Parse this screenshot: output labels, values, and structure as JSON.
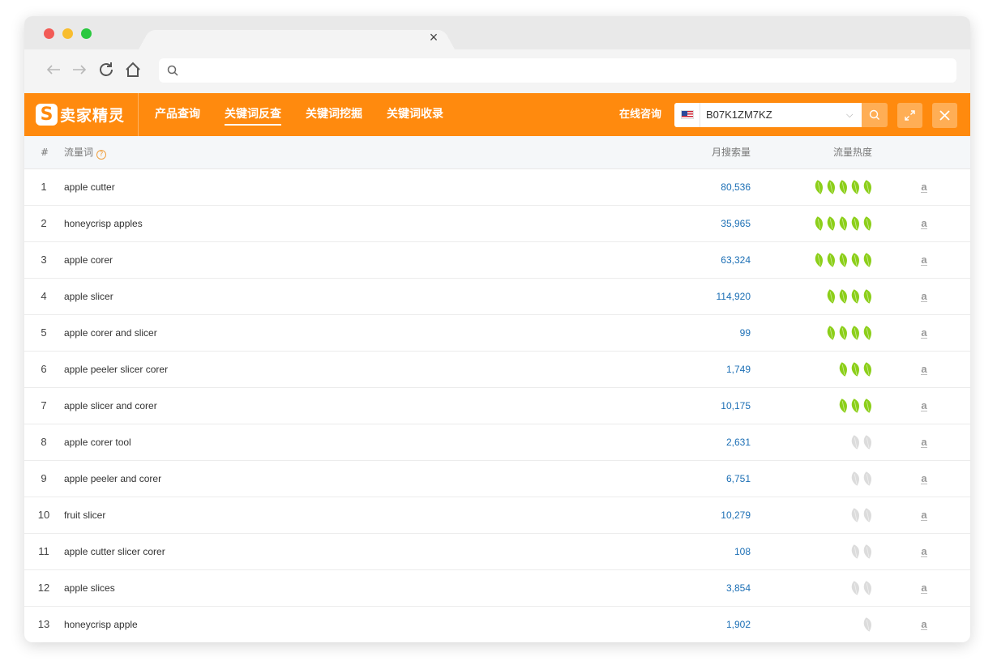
{
  "browser": {
    "tab_close": "×",
    "url": ""
  },
  "app": {
    "logo_mark": "S",
    "logo_text": "卖家精灵",
    "menu": [
      "产品查询",
      "关键词反查",
      "关键词挖掘",
      "关键词收录"
    ],
    "active_menu": 1,
    "consult_label": "在线咨询",
    "asin_value": "B07K1ZM7KZ",
    "caret": "⌵"
  },
  "table": {
    "headers": {
      "index": "#",
      "keyword": "流量词",
      "help": "?",
      "volume": "月搜索量",
      "heat": "流量热度"
    },
    "amazon_glyph": "a",
    "rows": [
      {
        "index": "1",
        "keyword": "apple cutter",
        "volume": "80,536",
        "heat": 5,
        "active": true
      },
      {
        "index": "2",
        "keyword": "honeycrisp apples",
        "volume": "35,965",
        "heat": 5,
        "active": true
      },
      {
        "index": "3",
        "keyword": "apple corer",
        "volume": "63,324",
        "heat": 5,
        "active": true
      },
      {
        "index": "4",
        "keyword": "apple slicer",
        "volume": "114,920",
        "heat": 4,
        "active": true
      },
      {
        "index": "5",
        "keyword": "apple corer and slicer",
        "volume": "99",
        "heat": 4,
        "active": true
      },
      {
        "index": "6",
        "keyword": "apple peeler slicer corer",
        "volume": "1,749",
        "heat": 3,
        "active": true
      },
      {
        "index": "7",
        "keyword": "apple slicer and corer",
        "volume": "10,175",
        "heat": 3,
        "active": true
      },
      {
        "index": "8",
        "keyword": "apple corer tool",
        "volume": "2,631",
        "heat": 2,
        "active": false
      },
      {
        "index": "9",
        "keyword": "apple peeler and corer",
        "volume": "6,751",
        "heat": 2,
        "active": false
      },
      {
        "index": "10",
        "keyword": "fruit slicer",
        "volume": "10,279",
        "heat": 2,
        "active": false
      },
      {
        "index": "11",
        "keyword": "apple cutter slicer corer",
        "volume": "108",
        "heat": 2,
        "active": false
      },
      {
        "index": "12",
        "keyword": "apple slices",
        "volume": "3,854",
        "heat": 2,
        "active": false
      },
      {
        "index": "13",
        "keyword": "honeycrisp apple",
        "volume": "1,902",
        "heat": 1,
        "active": false
      }
    ]
  },
  "colors": {
    "brand": "#ff8a0e",
    "leaf_active": "#8ccf1a",
    "leaf_inactive": "#dcdcdc",
    "volume_link": "#1c6fb5"
  },
  "icons": {
    "back": "arrow-left-icon",
    "forward": "arrow-right-icon",
    "reload": "reload-icon",
    "home": "home-icon",
    "search": "search-icon",
    "expand": "expand-icon",
    "close": "close-icon",
    "leaf": "leaf-icon",
    "amazon": "amazon-icon"
  }
}
